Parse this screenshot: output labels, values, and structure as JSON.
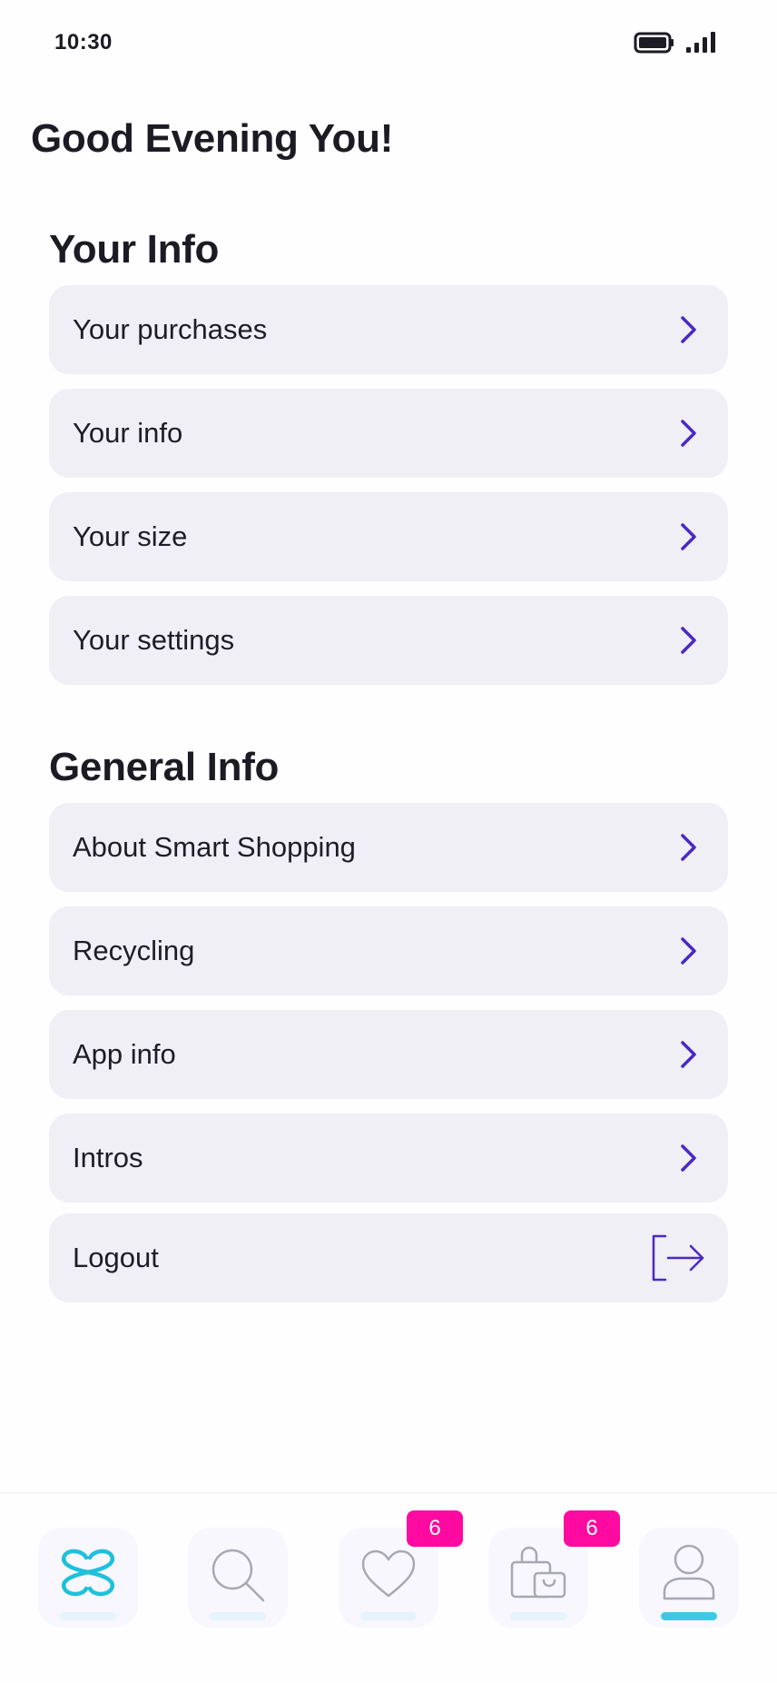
{
  "status_bar": {
    "time": "10:30",
    "icons": [
      "battery-icon",
      "signal-icon"
    ]
  },
  "greeting": "Good Evening You!",
  "your_info": {
    "title": "Your Info",
    "items": [
      {
        "label": "Your purchases",
        "icon": "chevron-right-icon"
      },
      {
        "label": "Your info",
        "icon": "chevron-right-icon"
      },
      {
        "label": "Your size",
        "icon": "chevron-right-icon"
      },
      {
        "label": "Your settings",
        "icon": "chevron-right-icon"
      }
    ]
  },
  "general_info": {
    "title": "General Info",
    "items": [
      {
        "label": "About Smart Shopping",
        "icon": "chevron-right-icon"
      },
      {
        "label": "Recycling",
        "icon": "chevron-right-icon"
      },
      {
        "label": "App info",
        "icon": "chevron-right-icon"
      },
      {
        "label": "Intros",
        "icon": "chevron-right-icon"
      },
      {
        "label": "Logout",
        "icon": "logout-icon"
      }
    ]
  },
  "tab_bar": {
    "tabs": [
      {
        "name": "home",
        "icon": "app-logo-icon",
        "active": false
      },
      {
        "name": "search",
        "icon": "search-icon",
        "active": false
      },
      {
        "name": "favorites",
        "icon": "heart-icon",
        "badge": "6",
        "active": false
      },
      {
        "name": "bag",
        "icon": "shopping-bag-icon",
        "badge": "6",
        "active": false
      },
      {
        "name": "profile",
        "icon": "user-icon",
        "active": true
      }
    ]
  },
  "colors": {
    "accent": "#4a28c6",
    "card_background": "#efeff5",
    "badge": "#ff0aa1",
    "active_indicator": "#3fc8e6",
    "logo": "#1fc0dc"
  }
}
